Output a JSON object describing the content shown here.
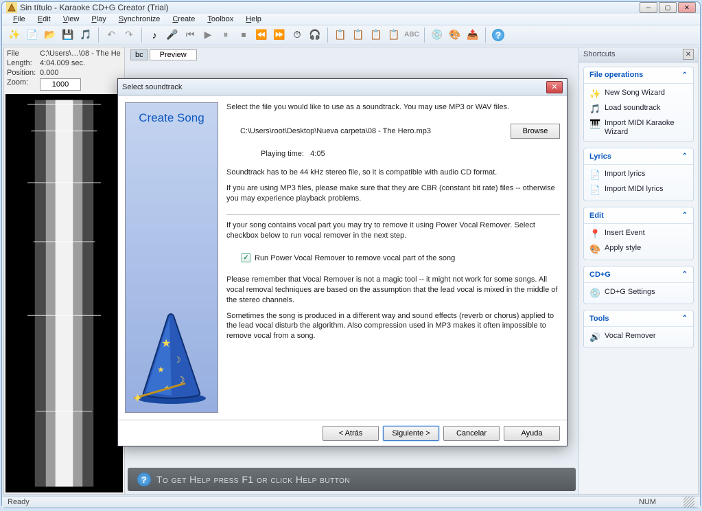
{
  "titlebar": {
    "text": "Sin título - Karaoke CD+G Creator (Trial)"
  },
  "menubar": {
    "items": [
      "File",
      "Edit",
      "View",
      "Play",
      "Synchronize",
      "Create",
      "Toolbox",
      "Help"
    ]
  },
  "info": {
    "file_label": "File",
    "file_value": "C:\\Users\\…\\08 - The He",
    "length_label": "Length:",
    "length_value": "4:04.009 sec.",
    "position_label": "Position:",
    "position_value": "0.000",
    "zoom_label": "Zoom:",
    "zoom_value": "1000"
  },
  "preview": {
    "tab1": "bc",
    "tab2": "Preview"
  },
  "help_strip": "To get Help press F1 or click Help button",
  "shortcuts": {
    "title": "Shortcuts",
    "groups": [
      {
        "title": "File operations",
        "items": [
          "New Song Wizard",
          "Load soundtrack",
          "Import MIDI Karaoke Wizard"
        ]
      },
      {
        "title": "Lyrics",
        "items": [
          "Import lyrics",
          "Import MIDI lyrics"
        ]
      },
      {
        "title": "Edit",
        "items": [
          "Insert Event",
          "Apply style"
        ]
      },
      {
        "title": "CD+G",
        "items": [
          "CD+G Settings"
        ]
      },
      {
        "title": "Tools",
        "items": [
          "Vocal Remover"
        ]
      }
    ]
  },
  "statusbar": {
    "ready": "Ready",
    "num": "NUM"
  },
  "modal": {
    "title": "Select soundtrack",
    "wizard_title": "Create Song",
    "intro": "Select the file you would like to use as a soundtrack. You may use MP3 or WAV files.",
    "file_path": "C:\\Users\\root\\Desktop\\Nueva carpeta\\08 - The Hero.mp3",
    "browse": "Browse",
    "playing_time_label": "Playing time:",
    "playing_time_value": "4:05",
    "note1": "Soundtrack has to be 44 kHz stereo file, so it is compatible with audio CD format.",
    "note2": "If you are using MP3 files, please make sure that they are CBR (constant bit rate) files -- otherwise you may experience playback problems.",
    "vocal_intro": "If your song contains vocal part you may try to remove it using Power Vocal Remover. Select checkbox below to run vocal remover in the next step.",
    "checkbox_label": "Run Power Vocal Remover to remove vocal part of the song",
    "disclaimer1": "Please remember that Vocal Remover is not a magic tool -- it might not work for some songs. All vocal removal techniques are based on the assumption that the lead vocal is mixed in the middle of the stereo channels.",
    "disclaimer2": "Sometimes the song is produced in a different way and sound effects (reverb or chorus) applied to the lead vocal disturb the algorithm. Also compression used in MP3 makes it often impossible to remove vocal from a song.",
    "buttons": {
      "back": "< Atrás",
      "next": "Siguiente >",
      "cancel": "Cancelar",
      "help": "Ayuda"
    }
  }
}
